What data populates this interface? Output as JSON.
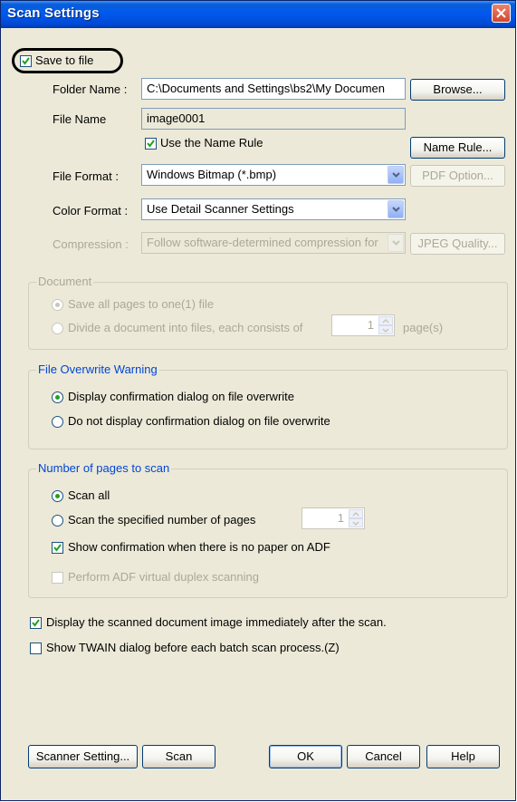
{
  "window": {
    "title": "Scan Settings"
  },
  "save_to_file": {
    "label": "Save to file",
    "checked": true
  },
  "folder": {
    "label": "Folder Name :",
    "value": "C:\\Documents and Settings\\bs2\\My Documen",
    "browse_label": "Browse..."
  },
  "file_name": {
    "label": "File Name",
    "value": "image0001"
  },
  "name_rule": {
    "checkbox_label": "Use the Name Rule",
    "checked": true,
    "button_label": "Name Rule..."
  },
  "file_format": {
    "label": "File Format :",
    "value": "Windows Bitmap (*.bmp)",
    "pdf_option_label": "PDF Option..."
  },
  "color_format": {
    "label": "Color Format :",
    "value": "Use Detail Scanner Settings"
  },
  "compression": {
    "label": "Compression :",
    "value": "Follow software-determined compression for",
    "jpeg_quality_label": "JPEG Quality..."
  },
  "document": {
    "legend": "Document",
    "option_all": "Save all pages to one(1) file",
    "option_divide": "Divide a document into files, each consists of",
    "pages_value": "1",
    "pages_unit": "page(s)"
  },
  "overwrite": {
    "legend": "File Overwrite Warning",
    "option_display": "Display confirmation dialog on file overwrite",
    "option_no_display": "Do not display confirmation dialog on file overwrite"
  },
  "pages_to_scan": {
    "legend": "Number of pages to scan",
    "option_all": "Scan all",
    "option_specified": "Scan the specified number of pages",
    "count_value": "1",
    "show_confirmation": "Show confirmation when there is no paper on ADF",
    "virtual_duplex": "Perform ADF virtual duplex scanning"
  },
  "display_after_scan": {
    "label": "Display the scanned document image immediately after the scan.",
    "checked": true
  },
  "show_twain": {
    "label": "Show TWAIN dialog before each batch scan process.(Z)",
    "checked": false
  },
  "buttons": {
    "scanner_setting": "Scanner Setting...",
    "scan": "Scan",
    "ok": "OK",
    "cancel": "Cancel",
    "help": "Help"
  },
  "colors": {
    "titlebar": "#0058ee",
    "dialog_bg": "#ece9d8",
    "group_legend": "#0046d5",
    "disabled_text": "#aca899",
    "radio_dot": "#21a121"
  },
  "icons": {
    "close": "close-icon",
    "check": "check-icon",
    "dropdown": "chevron-down-icon",
    "spin_up": "spin-up-icon",
    "spin_down": "spin-down-icon"
  }
}
